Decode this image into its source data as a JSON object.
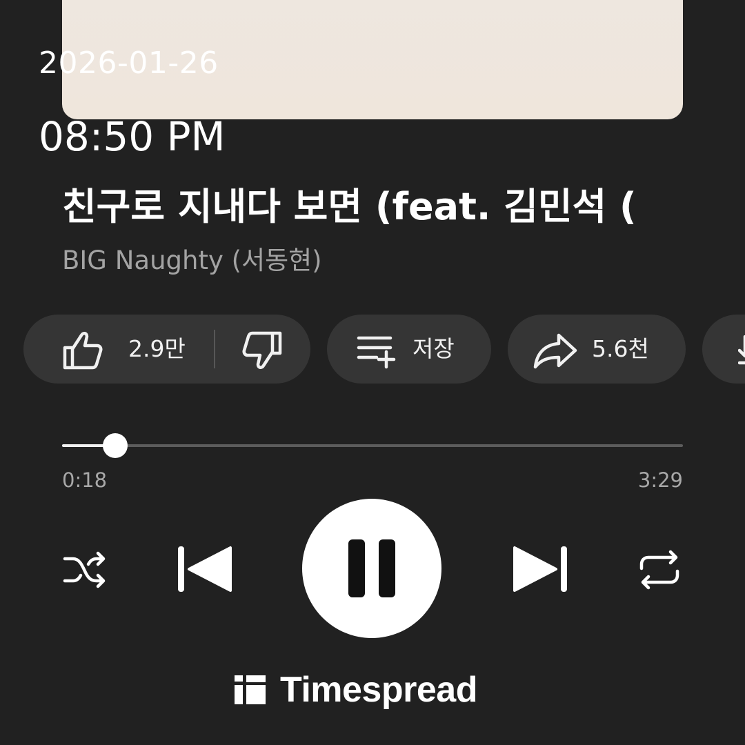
{
  "overlay": {
    "date": "2026-01-26",
    "time": "08:50 PM"
  },
  "track": {
    "title": "친구로 지내다 보면 (feat. 김민석 (",
    "artist": "BIG Naughty (서동현)"
  },
  "actions": {
    "like_count": "2.9만",
    "save_label": "저장",
    "share_count": "5.6천"
  },
  "player": {
    "elapsed": "0:18",
    "duration": "3:29",
    "progress_fraction": 0.086,
    "state": "playing"
  },
  "icons": {
    "like": "thumbs-up-icon",
    "dislike": "thumbs-down-icon",
    "save": "playlist-add-icon",
    "share": "share-arrow-icon",
    "shuffle": "shuffle-icon",
    "previous": "skip-previous-icon",
    "pause": "pause-icon",
    "next": "skip-next-icon",
    "repeat": "repeat-icon",
    "brand": "timespread-logo-icon"
  },
  "brand": {
    "name": "Timespread"
  },
  "colors": {
    "background": "#212121",
    "pill": "#353535",
    "secondary_text": "#a3a3a3",
    "accent": "#ffffff"
  }
}
